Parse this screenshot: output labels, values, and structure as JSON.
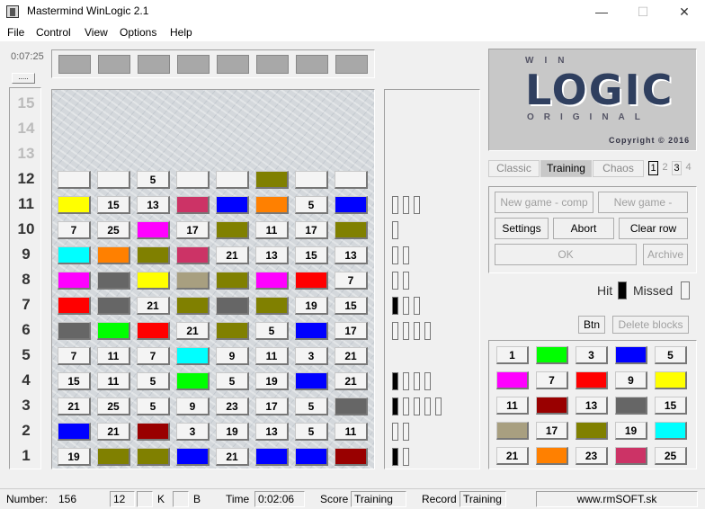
{
  "window": {
    "title": "Mastermind WinLogic 2.1",
    "minimize_icon": "minimize-icon",
    "maximize_icon": "maximize-icon",
    "close_icon": "close-icon"
  },
  "menu": [
    "File",
    "Control",
    "View",
    "Options",
    "Help"
  ],
  "timer": {
    "elapsed": "0:07:25",
    "button_label": "....."
  },
  "row_numbers": [
    "15",
    "14",
    "13",
    "12",
    "11",
    "10",
    "9",
    "8",
    "7",
    "6",
    "5",
    "4",
    "3",
    "2",
    "1"
  ],
  "colors": {
    "yellow": "#ffff00",
    "blue": "#0000ff",
    "orange": "#ff8000",
    "green": "#00ff00",
    "magenta": "#ff00ff",
    "red": "#ff0000",
    "olive": "#808000",
    "gray": "#666666",
    "cyan": "#00ffff",
    "darkred": "#990000",
    "pink": "#cc3366",
    "khaki": "#a89f80"
  },
  "board": [
    [
      "",
      "",
      "5",
      "",
      "",
      "@olive",
      "",
      ""
    ],
    [
      "@yellow",
      "15",
      "13",
      "@pink",
      "@blue",
      "@orange",
      "5",
      "@blue"
    ],
    [
      "7",
      "25",
      "@magenta",
      "17",
      "@olive",
      "11",
      "17",
      "@olive"
    ],
    [
      "@cyan",
      "@orange",
      "@olive",
      "@pink",
      "21",
      "13",
      "15",
      "13"
    ],
    [
      "@magenta",
      "@gray",
      "@yellow",
      "@khaki",
      "@olive",
      "@magenta",
      "@red",
      "7"
    ],
    [
      "@red",
      "@gray",
      "21",
      "@olive",
      "@gray",
      "@olive",
      "19",
      "15"
    ],
    [
      "@gray",
      "@green",
      "@red",
      "21",
      "@olive",
      "5",
      "@blue",
      "17"
    ],
    [
      "7",
      "11",
      "7",
      "@cyan",
      "9",
      "11",
      "3",
      "21"
    ],
    [
      "15",
      "11",
      "5",
      "@green",
      "5",
      "19",
      "@blue",
      "21"
    ],
    [
      "21",
      "25",
      "5",
      "9",
      "23",
      "17",
      "5",
      "@gray"
    ],
    [
      "@blue",
      "21",
      "@darkred",
      "3",
      "19",
      "13",
      "5",
      "11"
    ],
    [
      "19",
      "@olive",
      "@olive",
      "@blue",
      "21",
      "@blue",
      "@blue",
      "@darkred"
    ]
  ],
  "feedback": [
    {
      "hits": 0,
      "misses": 3
    },
    {
      "hits": 0,
      "misses": 1
    },
    {
      "hits": 0,
      "misses": 2
    },
    {
      "hits": 0,
      "misses": 2
    },
    {
      "hits": 1,
      "misses": 2
    },
    {
      "hits": 0,
      "misses": 4
    },
    {
      "hits": 0,
      "misses": 0
    },
    {
      "hits": 1,
      "misses": 3
    },
    {
      "hits": 1,
      "misses": 4
    },
    {
      "hits": 0,
      "misses": 2
    },
    {
      "hits": 1,
      "misses": 1
    }
  ],
  "logo": {
    "win": "WIN",
    "main": "LOGIC",
    "original": "ORIGINAL",
    "copyright": "Copyright © 2016"
  },
  "modes": [
    "Classic",
    "Training",
    "Chaos"
  ],
  "selected_mode": "Training",
  "players": [
    "1",
    "2",
    "3",
    "4"
  ],
  "selected_player": "1",
  "buttons": {
    "new_game_comp": "New game - comp",
    "new_game_player": "New game - player",
    "settings": "Settings",
    "abort": "Abort",
    "clear_row": "Clear row",
    "ok": "OK",
    "archive": "Archive",
    "btn": "Btn",
    "delete_blocks": "Delete blocks"
  },
  "hit_label": "Hit",
  "missed_label": "Missed",
  "palette": [
    [
      "1",
      "@green",
      "3",
      "@blue",
      "5"
    ],
    [
      "@magenta",
      "7",
      "@red",
      "9",
      "@yellow"
    ],
    [
      "11",
      "@darkred",
      "13",
      "@gray",
      "15"
    ],
    [
      "@khaki",
      "17",
      "@olive",
      "19",
      "@cyan"
    ],
    [
      "21",
      "@orange",
      "23",
      "@pink",
      "25"
    ]
  ],
  "status": {
    "number_label": "Number:",
    "number_value": "156",
    "field_12": "12",
    "k_label": "K",
    "b_label": "B",
    "time_label": "Time",
    "time_value": "0:02:06",
    "score_label": "Score",
    "score_value": "Training",
    "record_label": "Record",
    "record_value": "Training",
    "website": "www.rmSOFT.sk"
  }
}
